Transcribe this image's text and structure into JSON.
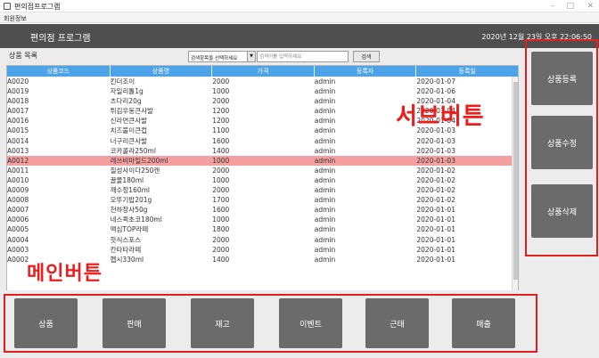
{
  "window": {
    "title": "편의점프로그램",
    "controls": [
      "–",
      "□",
      "✕"
    ]
  },
  "menubar": {
    "items": [
      "회원정보"
    ]
  },
  "header": {
    "brand": "편의점 프로그램",
    "datetime": "2020년 12월 23일 오후 22:06:50"
  },
  "list": {
    "title": "상품 목록",
    "search_select": "검색항목을 선택하세요",
    "search_placeholder": "검색어를 입력하세요",
    "search_button": "검색"
  },
  "table": {
    "columns": [
      "상품코드",
      "상품명",
      "가격",
      "등록자",
      "등록일"
    ],
    "selected_index": 8,
    "rows": [
      [
        "A0020",
        "킨더조이",
        "2000",
        "admin",
        "2020-01-07"
      ],
      [
        "A0019",
        "자일리톨1g",
        "1000",
        "admin",
        "2020-01-06"
      ],
      [
        "A0018",
        "츠다리20g",
        "2000",
        "admin",
        "2020-01-04"
      ],
      [
        "A0017",
        "튀김우동큰사발",
        "1200",
        "admin",
        "2020-01-04"
      ],
      [
        "A0016",
        "신라면큰사발",
        "1200",
        "admin",
        "2020-01-04"
      ],
      [
        "A0015",
        "치즈불이큰컵",
        "1100",
        "admin",
        "2020-01-03"
      ],
      [
        "A0014",
        "너구리큰사발",
        "1600",
        "admin",
        "2020-01-03"
      ],
      [
        "A0013",
        "코카콜라250ml",
        "1400",
        "admin",
        "2020-01-03"
      ],
      [
        "A0012",
        "레쓰비마일드200ml",
        "1000",
        "admin",
        "2020-01-03"
      ],
      [
        "A0011",
        "칠성사이다250캔",
        "2000",
        "admin",
        "2020-01-02"
      ],
      [
        "A0010",
        "꿀물180ml",
        "1000",
        "admin",
        "2020-01-02"
      ],
      [
        "A0009",
        "깨수정160ml",
        "2000",
        "admin",
        "2020-01-02"
      ],
      [
        "A0008",
        "오뚜기밥201g",
        "1700",
        "admin",
        "2020-01-02"
      ],
      [
        "A0007",
        "천하장사50g",
        "1600",
        "admin",
        "2020-01-01"
      ],
      [
        "A0006",
        "네스퀵초코180ml",
        "1000",
        "admin",
        "2020-01-01"
      ],
      [
        "A0005",
        "맥심TOP라떼",
        "1800",
        "admin",
        "2020-01-01"
      ],
      [
        "A0004",
        "핫식스포스",
        "2000",
        "admin",
        "2020-01-01"
      ],
      [
        "A0003",
        "칸타타라떼",
        "2000",
        "admin",
        "2020-01-01"
      ],
      [
        "A0002",
        "펩시330ml",
        "1400",
        "admin",
        "2020-01-01"
      ]
    ]
  },
  "sub_buttons": [
    "상품등록",
    "상품수정",
    "상품삭제"
  ],
  "main_buttons": [
    "상품",
    "판매",
    "재고",
    "이벤트",
    "근태",
    "매출"
  ],
  "annotations": {
    "sub": "서브버튼",
    "main": "메인버튼"
  },
  "colors": {
    "header_bg": "#4f4f4f",
    "table_header": "#4ca3e8",
    "selected_row": "#f5a0a0",
    "button_bg": "#6b6b6b",
    "annotation": "#ee1c1c"
  }
}
